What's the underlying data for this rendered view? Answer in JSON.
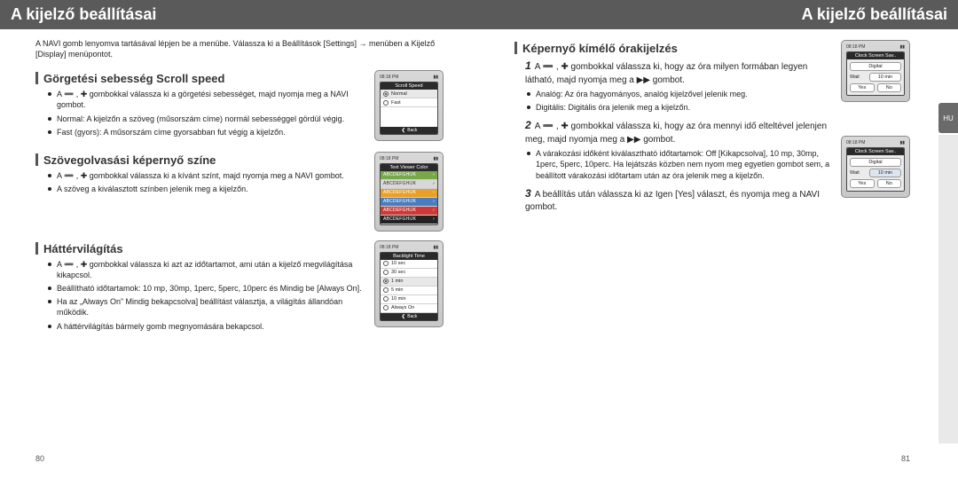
{
  "left": {
    "header": "A kijelző beállításai",
    "intro": "A NAVI gomb lenyomva tartásával lépjen be a menübe. Válassza ki a Beállítások [Settings] → menüben a Kijelző [Display] menüpontot.",
    "scroll": {
      "title": "Görgetési sebesség  Scroll speed",
      "bullets": [
        "A ➖ , ✚ gombokkal válassza ki a görgetési sebességet, majd nyomja meg a NAVI gombot.",
        "Normal: A kijelzőn a szöveg (műsorszám címe) normál sebességgel gördül végig.",
        "Fast (gyors): A műsorszám  címe gyorsabban fut végig a kijelzőn."
      ],
      "device": {
        "title": "Scroll Speed",
        "options": [
          "Normal",
          "Fast"
        ],
        "selected": 0,
        "back": "Back",
        "clock": "08:18 PM"
      }
    },
    "textcolor": {
      "title": "Szövegolvasási képernyő színe",
      "bullets": [
        "A ➖ , ✚ gombokkal válassza ki a kívánt színt, majd nyomja meg a NAVI gombot.",
        "A szöveg a kiválasztott színben jelenik meg a kijelzőn."
      ],
      "device": {
        "title": "Text Viewer Color",
        "sample": "ABCDEFGHIJK",
        "colors": [
          "#79a84a",
          "#d8d8d8",
          "#e8a028",
          "#4a7dc0",
          "#d03838",
          "#222222"
        ],
        "clock": "08:18 PM"
      }
    },
    "backlight": {
      "title": "Háttérvilágítás",
      "bullets": [
        "A ➖ , ✚ gombokkal válassza ki azt az időtartamot, ami után a kijelző megvilágítása kikapcsol.",
        "Beállítható időtartamok: 10 mp, 30mp, 1perc, 5perc, 10perc és Mindig be [Always On].",
        "Ha az „Always On” Mindig bekapcsolva] beállítást választja, a világítás állandóan működik.",
        "A háttérvilágítás bármely gomb megnyomására bekapcsol."
      ],
      "device": {
        "title": "Backlight Time",
        "options": [
          "10 sec",
          "30 sec",
          "1 min",
          "5 min",
          "10 min",
          "Always On"
        ],
        "selected": 2,
        "back": "Back",
        "clock": "08:18 PM"
      }
    },
    "pagenum": "80"
  },
  "right": {
    "header": "A kijelző beállításai",
    "tab": "HU",
    "clocksaver": {
      "title": "Képernyő kímélő órakijelzés",
      "step1": "A ➖ , ✚ gombokkal válassza ki, hogy az óra milyen formában legyen látható, majd nyomja meg a ▶▶ gombot.",
      "sub1": [
        "Analóg: Az óra hagyományos, analóg kijelzővel jelenik meg.",
        "Digitális: Digitális óra jelenik meg a kijelzőn."
      ],
      "step2": "A ➖ , ✚ gombokkal válassza ki, hogy az óra mennyi idő elteltével jelenjen meg, majd nyomja meg a ▶▶ gombot.",
      "sub2": [
        "A várakozási időként kiválasztható időtartamok: Off [Kikapcsolva], 10 mp, 30mp, 1perc, 5perc, 10perc. Ha lejátszás közben nem nyom meg egyetlen gombot sem, a beállított várakozási időtartam után az óra jelenik meg a kijelzőn."
      ],
      "step3": "A beállítás után válassza ki az Igen [Yes] választ, és nyomja meg a NAVI gombot.",
      "device1": {
        "title": "Clock Screen Sav..",
        "type": "Digital",
        "waitLabel": "Wait",
        "waitValue": "10 min",
        "yes": "Yes",
        "no": "No",
        "clock": "08:18 PM"
      },
      "device2": {
        "title": "Clock Screen Sav..",
        "type": "Digital",
        "waitLabel": "Wait",
        "waitValue": "10 min",
        "yes": "Yes",
        "no": "No",
        "clock": "08:18 PM"
      }
    },
    "pagenum": "81"
  }
}
